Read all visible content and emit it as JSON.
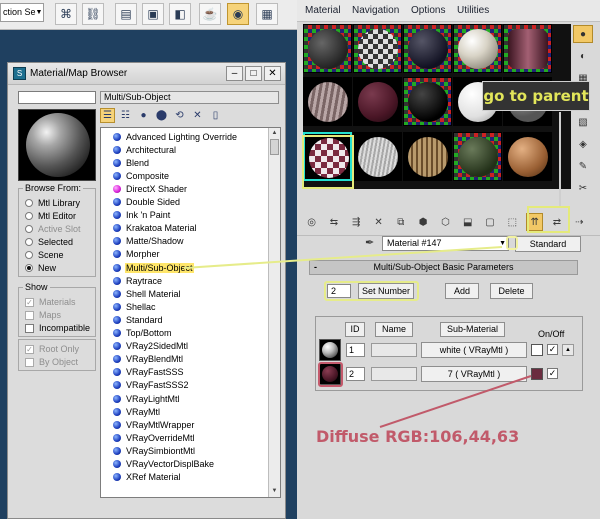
{
  "toolbar": {
    "selection_field": "ction Se",
    "icons": [
      "select-icon",
      "link-icon",
      "bind-icon",
      "render-setup-icon",
      "render-frame-icon",
      "render-icon",
      "material-editor-icon"
    ]
  },
  "browser": {
    "title": "Material/Map Browser",
    "selected_name": "Multi/Sub-Object",
    "list_items": [
      "Advanced Lighting Override",
      "Architectural",
      "Blend",
      "Composite",
      "DirectX Shader",
      "Double Sided",
      "Ink 'n Paint",
      "Krakatoa Material",
      "Matte/Shadow",
      "Morpher",
      "Multi/Sub-Object",
      "Raytrace",
      "Shell Material",
      "Shellac",
      "Standard",
      "Top/Bottom",
      "VRay2SidedMtl",
      "VRayBlendMtl",
      "VRayFastSSS",
      "VRayFastSSS2",
      "VRayLightMtl",
      "VRayMtl",
      "VRayMtlWrapper",
      "VRayOverrideMtl",
      "VRaySimbiontMtl",
      "VRayVectorDisplBake",
      "XRef Material"
    ],
    "selected_index": 10,
    "browse_from": {
      "title": "Browse From:",
      "options": [
        "Mtl Library",
        "Mtl Editor",
        "Active Slot",
        "Selected",
        "Scene",
        "New"
      ],
      "selected": "New"
    },
    "show": {
      "title": "Show",
      "options": [
        "Materials",
        "Maps",
        "Incompatible"
      ]
    },
    "extra_options": [
      "Root Only",
      "By Object"
    ]
  },
  "editor": {
    "menu": [
      "Material",
      "Navigation",
      "Options",
      "Utilities"
    ],
    "material_name": "Material #147",
    "type_button": "Standard",
    "rollout_title": "Multi/Sub-Object Basic Parameters",
    "number_of_materials": "2",
    "set_number_label": "Set Number",
    "add_label": "Add",
    "delete_label": "Delete",
    "headers": {
      "id": "ID",
      "name": "Name",
      "sub_material": "Sub-Material",
      "onoff": "On/Off"
    },
    "rows": [
      {
        "id": "1",
        "sub_material": "white  ( VRayMtl )",
        "color": "#ffffff"
      },
      {
        "id": "2",
        "sub_material": "7  ( VRayMtl )",
        "color": "#6a2c3f"
      }
    ]
  },
  "annotations": {
    "go_to_parent": "go to parent",
    "diffuse": "Diffuse RGB:106,44,63"
  },
  "colors": {
    "annotation_yellow": "#e4ea7a",
    "diffuse_text": "#c15a6a",
    "swatch_maroon": "#6a2c3f",
    "highlight": "#ffe66a"
  }
}
